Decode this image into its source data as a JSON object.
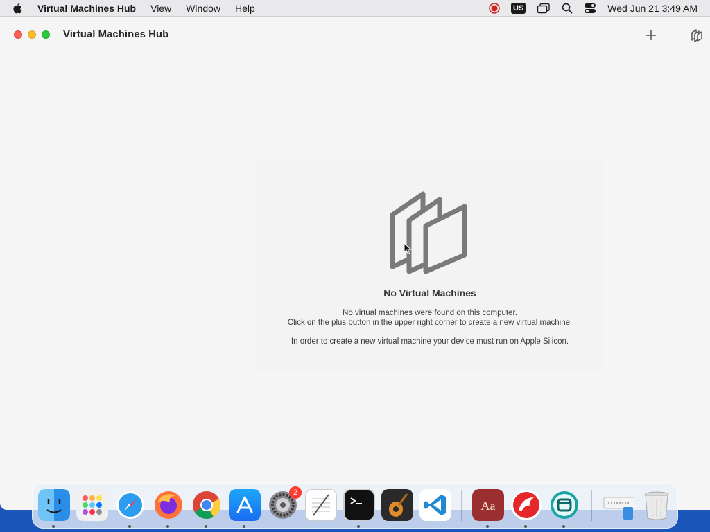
{
  "menubar": {
    "app_name": "Virtual Machines Hub",
    "items": [
      "View",
      "Window",
      "Help"
    ],
    "keyboard_layout": "US",
    "clock": "Wed Jun 21  3:49 AM"
  },
  "window": {
    "title": "Virtual Machines Hub",
    "add_button_icon": "plus-icon",
    "vm_button_icon": "vm-stack-icon"
  },
  "empty_state": {
    "icon": "vm-stack-icon",
    "title": "No Virtual Machines",
    "line1": "No virtual machines were found on this computer.",
    "line2": "Click on the plus button in the upper right corner to create a new virtual machine.",
    "note": "In order to create a new virtual machine your device must run on Apple Silicon."
  },
  "dock": {
    "apps": [
      {
        "name": "Finder",
        "icon": "finder-icon",
        "running": true
      },
      {
        "name": "Launchpad",
        "icon": "launchpad-icon",
        "running": false
      },
      {
        "name": "Safari",
        "icon": "safari-icon",
        "running": true
      },
      {
        "name": "Firefox",
        "icon": "firefox-icon",
        "running": true
      },
      {
        "name": "Chrome",
        "icon": "chrome-icon",
        "running": true
      },
      {
        "name": "App Store",
        "icon": "app-store-icon",
        "running": true
      },
      {
        "name": "System Settings",
        "icon": "system-settings-icon",
        "running": false,
        "badge": "2"
      },
      {
        "name": "TextEdit",
        "icon": "textedit-icon",
        "running": false
      },
      {
        "name": "Terminal",
        "icon": "terminal-icon",
        "running": true
      },
      {
        "name": "GarageBand",
        "icon": "garageband-icon",
        "running": false
      },
      {
        "name": "VS Code",
        "icon": "vscode-icon",
        "running": false
      },
      {
        "name": "Dictionary",
        "icon": "dictionary-icon",
        "running": true
      },
      {
        "name": "Red App",
        "icon": "red-bird-icon",
        "running": true
      },
      {
        "name": "Virtual Machines Hub",
        "icon": "vm-hub-icon",
        "running": true
      },
      {
        "name": "Downloads",
        "icon": "downloads-stack-icon",
        "running": false
      },
      {
        "name": "Trash",
        "icon": "trash-icon",
        "running": false
      }
    ]
  },
  "colors": {
    "accent_red": "#fe5f57",
    "accent_yellow": "#febc2e",
    "accent_green": "#28c840",
    "badge_red": "#ff3b30"
  }
}
